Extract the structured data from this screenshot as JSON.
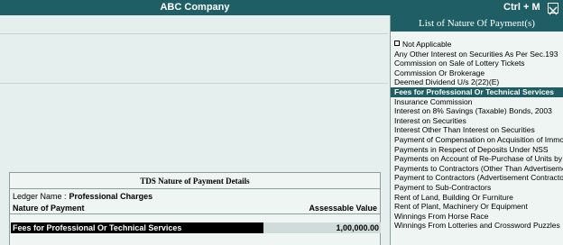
{
  "window": {
    "title": "ABC Company",
    "shortcut": "Ctrl + M"
  },
  "details": {
    "title": "TDS Nature of Payment Details",
    "ledger_label": "Ledger Name :",
    "ledger_value": "Professional Charges",
    "columns": {
      "nature": "Nature of Payment",
      "assessable": "Assessable Value"
    },
    "entry": {
      "nature": "Fees for Professional Or Technical Services",
      "amount": "1,00,000.00"
    }
  },
  "panel": {
    "title": "List of Nature Of Payment(s)",
    "items": [
      "Not Applicable",
      "Any Other Interest on Securities As Per Sec.193",
      "Commission on Sale of Lottery Tickets",
      "Commission Or Brokerage",
      "Deemed Dividend U/s 2(22)(E)",
      "Fees for Professional Or Technical Services",
      "Insurance Commission",
      "Interest on 8% Savings (Taxable) Bonds, 2003",
      "Interest on Securities",
      "Interest Other Than Interest on Securities",
      "Payment of Compensation on Acquisition of Immovable Property",
      "Payments in Respect of Deposits Under NSS",
      "Payments on Account of Re-Purchase of Units by ...",
      "Payments to Contractors (Other Than Advertisement)",
      "Payment to Contractors (Advertisement Contractors)",
      "Payment to Sub-Contractors",
      "Rent of Land, Building Or Furniture",
      "Rent of Plant, Machinery Or Equipment",
      "Winnings From Horse Race",
      "Winnings From Lotteries and Crossword Puzzles"
    ],
    "selected_index": 5
  },
  "colors": {
    "titlebar": "#1e5e64",
    "background": "#e5efed",
    "selection": "#1e5e64"
  }
}
